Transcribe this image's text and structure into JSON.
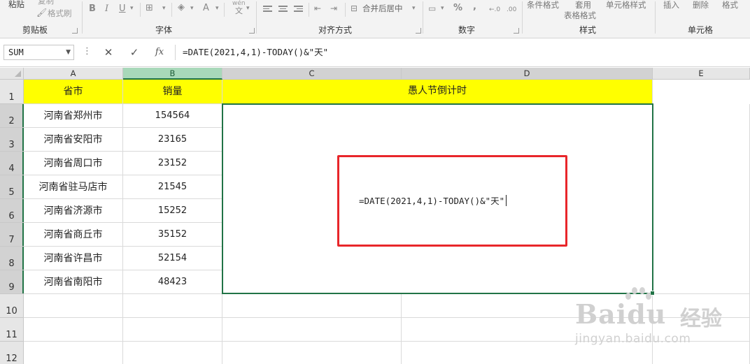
{
  "ribbon": {
    "clipboard": {
      "paste": "粘贴",
      "copy": "复制",
      "format_painter": "格式刷",
      "group": "剪贴板"
    },
    "font": {
      "bold": "B",
      "italic": "I",
      "underline": "U",
      "font_color": "A",
      "wen": "wén",
      "group": "字体"
    },
    "alignment": {
      "merge_center": "合并后居中",
      "group": "对齐方式"
    },
    "number": {
      "percent": "%",
      "comma": ",",
      "inc_decimal": "←.0",
      "dec_decimal": ".00",
      "group": "数字"
    },
    "styles": {
      "conditional": "条件格式",
      "table": "套用",
      "table2": "表格格式",
      "cell_styles": "单元格样式",
      "group": "样式"
    },
    "cells": {
      "insert": "插入",
      "delete": "删除",
      "format": "格式",
      "group": "单元格"
    }
  },
  "formula_bar": {
    "name_box": "SUM",
    "cancel": "✕",
    "enter": "✓",
    "fx": "fx",
    "content": "=DATE(2021,4,1)-TODAY()&\"天\""
  },
  "columns": [
    "A",
    "B",
    "C",
    "D",
    "E"
  ],
  "rows": [
    "1",
    "2",
    "3",
    "4",
    "5",
    "6",
    "7",
    "8",
    "9",
    "10",
    "11",
    "12"
  ],
  "header_row": {
    "province_city": "省市",
    "sales": "销量",
    "countdown": "愚人节倒计时"
  },
  "data_rows": [
    {
      "city": "河南省郑州市",
      "sales": "154564"
    },
    {
      "city": "河南省安阳市",
      "sales": "23165"
    },
    {
      "city": "河南省周口市",
      "sales": "23152"
    },
    {
      "city": "河南省驻马店市",
      "sales": "21545"
    },
    {
      "city": "河南省济源市",
      "sales": "15252"
    },
    {
      "city": "河南省商丘市",
      "sales": "35152"
    },
    {
      "city": "河南省许昌市",
      "sales": "52154"
    },
    {
      "city": "河南省南阳市",
      "sales": "48423"
    }
  ],
  "editing_formula": "=DATE(2021,4,1)-TODAY()&\"天\"",
  "watermark": {
    "brand": "Bai",
    "brand2": "du",
    "cn": "经验",
    "url": "jingyan.baidu.com"
  },
  "colors": {
    "accent": "#217346",
    "header_fill": "#ffff00",
    "highlight": "#e8262a"
  }
}
